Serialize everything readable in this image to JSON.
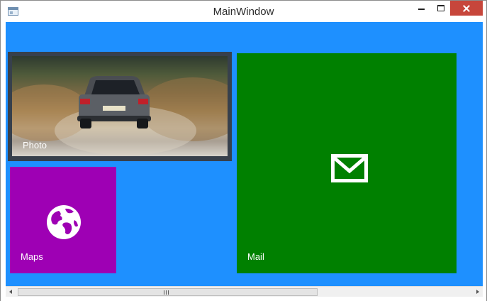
{
  "window": {
    "title": "MainWindow",
    "controls": [
      "minimize-icon",
      "maximize-icon",
      "close-icon"
    ]
  },
  "colors": {
    "client_background": "#1e90ff",
    "photo_tile_border": "#37404c",
    "maps_tile": "#9e00b4",
    "mail_tile": "#008000",
    "close_button": "#c7463b"
  },
  "tiles": {
    "photo": {
      "label": "Photo",
      "icon": "photo-image"
    },
    "maps": {
      "label": "Maps",
      "icon": "globe-icon"
    },
    "mail": {
      "label": "Mail",
      "icon": "envelope-icon"
    }
  },
  "scrollbar": {
    "orientation": "horizontal",
    "position": 0.0,
    "visible_fraction": 0.66
  }
}
